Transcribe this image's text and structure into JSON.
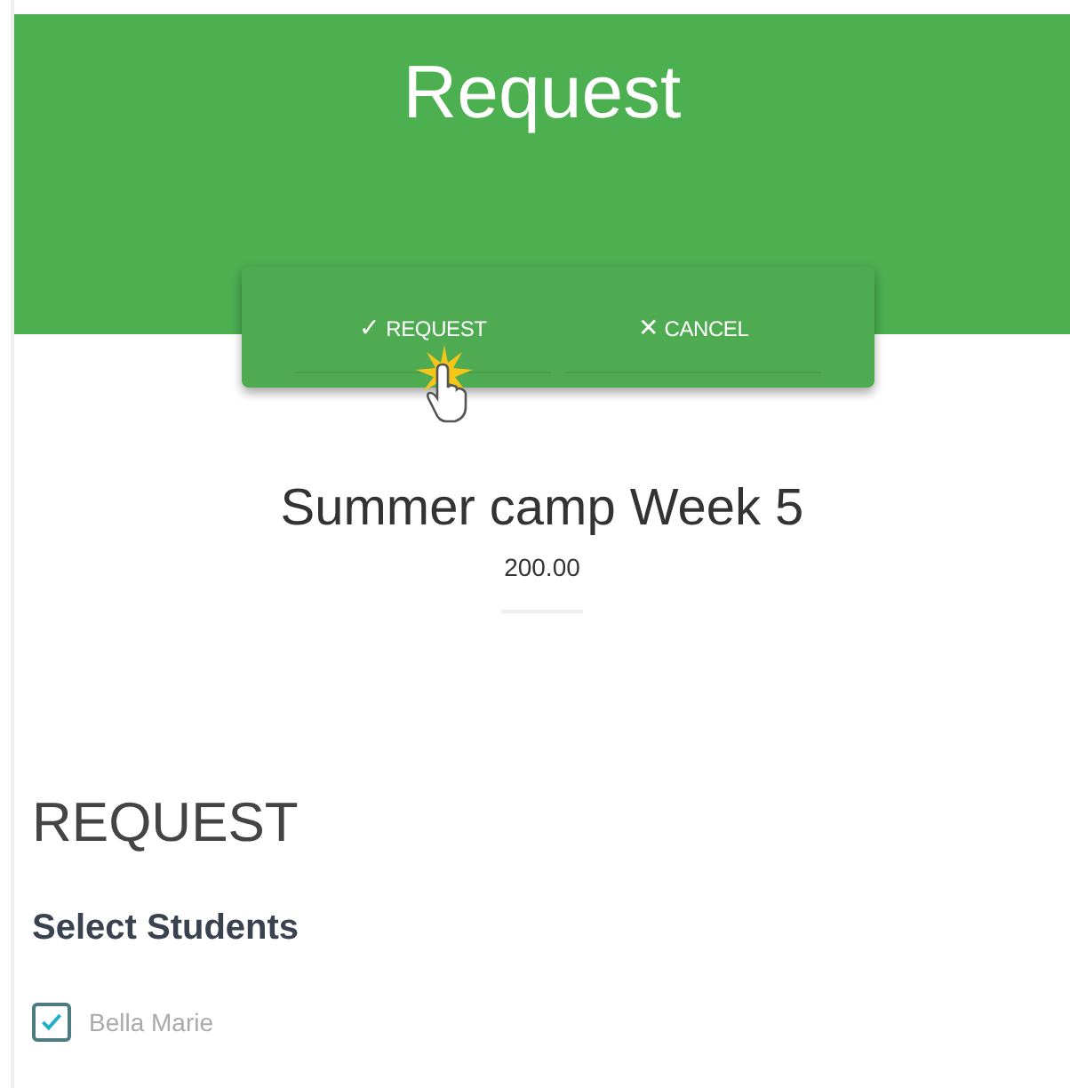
{
  "header": {
    "title": "Request"
  },
  "actions": [
    {
      "icon": "✓",
      "label": "REQUEST"
    },
    {
      "icon": "✕",
      "label": "CANCEL"
    }
  ],
  "item": {
    "name": "Summer camp Week 5",
    "price": "200.00"
  },
  "section": {
    "title": "REQUEST",
    "subtitle": "Select Students"
  },
  "students": [
    {
      "name": "Bella Marie",
      "checked": true
    }
  ]
}
